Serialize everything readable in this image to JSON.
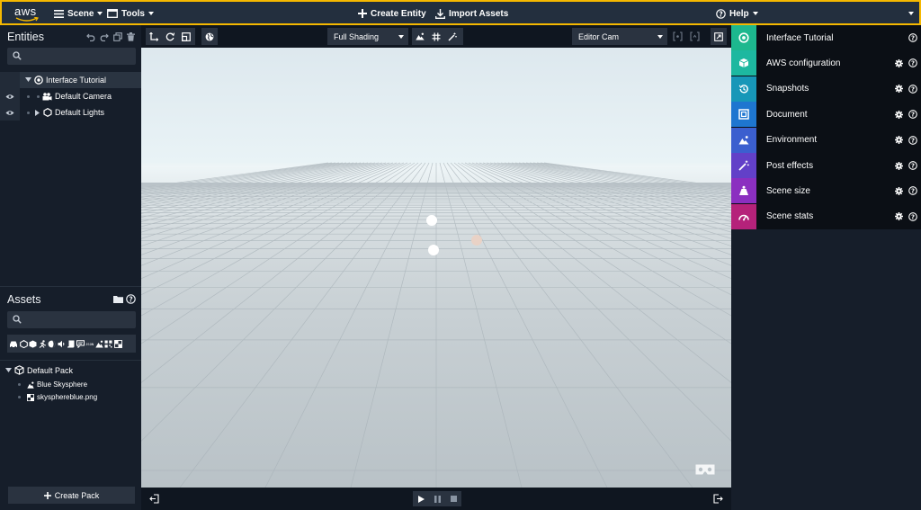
{
  "topbar": {
    "logo": "aws",
    "menus": [
      {
        "label": "Scene",
        "icon": "hamburger-icon"
      },
      {
        "label": "Tools",
        "icon": "window-icon"
      }
    ],
    "center_actions": [
      {
        "label": "Create Entity",
        "icon": "plus-icon"
      },
      {
        "label": "Import Assets",
        "icon": "download-icon"
      }
    ],
    "help_label": "Help",
    "accent_color": "#f5b800"
  },
  "entities": {
    "title": "Entities",
    "search_placeholder": "",
    "tree": [
      {
        "label": "Interface Tutorial",
        "icon": "target-icon",
        "level": 0
      },
      {
        "label": "Default Camera",
        "icon": "camera-icon",
        "level": 1
      },
      {
        "label": "Default Lights",
        "icon": "hexagon-icon",
        "level": 1
      }
    ]
  },
  "assets": {
    "title": "Assets",
    "search_placeholder": "",
    "pack": {
      "label": "Default Pack",
      "items": [
        {
          "label": "Blue Skysphere",
          "icon": "mountain-icon"
        },
        {
          "label": "skysphereblue.png",
          "icon": "checker-icon"
        }
      ]
    },
    "create_pack_label": "Create Pack"
  },
  "viewport": {
    "shading": "Full Shading",
    "camera": "Editor Cam",
    "horizon_color": "#eef5f7",
    "ground_color": "#c2cace"
  },
  "right_panel": {
    "items": [
      {
        "label": "Interface Tutorial",
        "icon": "target-icon",
        "color": "#1db88e",
        "settings": false
      },
      {
        "label": "AWS configuration",
        "icon": "cube-icon",
        "color": "#1db8a0",
        "settings": true
      },
      {
        "label": "Snapshots",
        "icon": "history-icon",
        "color": "#1797b8",
        "settings": true
      },
      {
        "label": "Document",
        "icon": "frame-icon",
        "color": "#1e76d0",
        "settings": true
      },
      {
        "label": "Environment",
        "icon": "mountain-icon",
        "color": "#3b5fcf",
        "settings": true
      },
      {
        "label": "Post effects",
        "icon": "wand-icon",
        "color": "#6240c8",
        "settings": true
      },
      {
        "label": "Scene size",
        "icon": "weight-icon",
        "color": "#8b2fc0",
        "settings": true
      },
      {
        "label": "Scene stats",
        "icon": "gauge-icon",
        "color": "#b5227a",
        "settings": true
      }
    ]
  }
}
